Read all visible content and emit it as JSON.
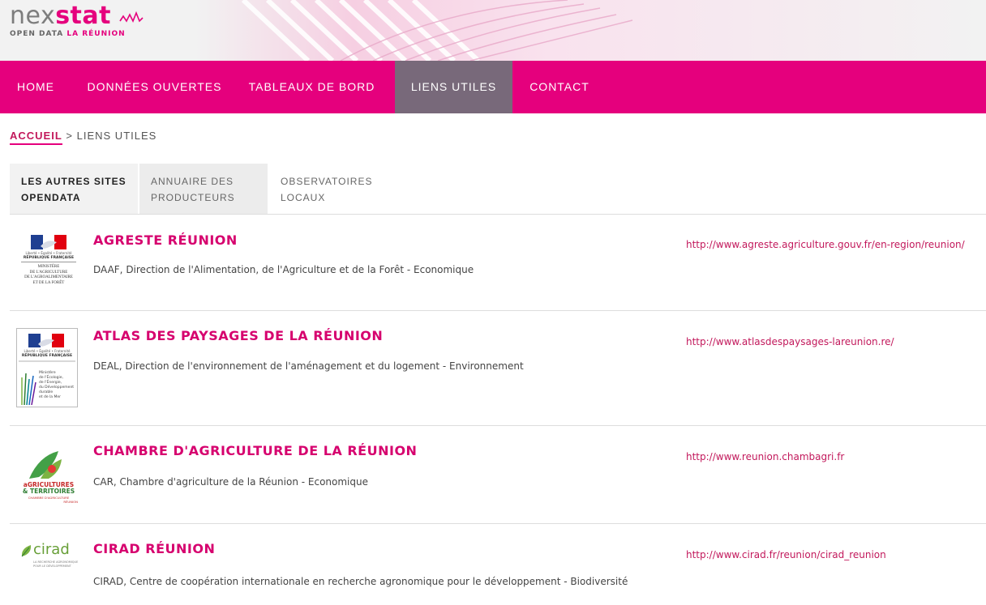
{
  "header": {
    "logo_text_1": "nex",
    "logo_text_2": "stat",
    "logo_sub_1": "OPEN DATA",
    "logo_sub_2": "LA RÉUNION"
  },
  "nav": {
    "items": [
      {
        "label": "HOME"
      },
      {
        "label": "DONNÉES OUVERTES"
      },
      {
        "label": "TABLEAUX DE BORD"
      },
      {
        "label": "LIENS UTILES"
      },
      {
        "label": "CONTACT"
      }
    ],
    "active_index": 3
  },
  "breadcrumb": {
    "home": "ACCUEIL",
    "separator": ">",
    "current": "LIENS UTILES"
  },
  "tabs": [
    {
      "line1": "LES AUTRES SITES",
      "line2": "OPENDATA"
    },
    {
      "line1": "ANNUAIRE DES",
      "line2": "PRODUCTEURS"
    },
    {
      "line1": "OBSERVATOIRES",
      "line2": "LOCAUX"
    }
  ],
  "items": [
    {
      "title": "AGRESTE RÉUNION",
      "description": "DAAF, Direction de l'Alimentation, de l'Agriculture et de la Forêt - Economique",
      "url": "http://www.agreste.agriculture.gouv.fr/en-region/reunion/",
      "logo": {
        "motto": "Liberté • Égalité • Fraternité",
        "republic": "RÉPUBLIQUE FRANÇAISE",
        "ministry_lines": [
          "MINISTÈRE",
          "DE L'AGRICULTURE",
          "DE L'AGROALIMENTAIRE",
          "ET DE LA FORÊT"
        ]
      }
    },
    {
      "title": "ATLAS DES PAYSAGES DE LA RÉUNION",
      "description": "DEAL, Direction de l'environnement de l'aménagement et du logement - Environnement",
      "url": "http://www.atlasdespaysages-lareunion.re/",
      "logo": {
        "motto": "Liberté • Égalité • Fraternité",
        "republic": "RÉPUBLIQUE FRANÇAISE",
        "ministry_lines": [
          "Ministère",
          "de l'Écologie,",
          "de l'Énergie,",
          "du Développement",
          "durable",
          "et de la Mer"
        ]
      }
    },
    {
      "title": "CHAMBRE D'AGRICULTURE DE LA RÉUNION",
      "description": "CAR, Chambre d'agriculture de la Réunion - Economique",
      "url": "http://www.reunion.chambagri.fr",
      "logo": {
        "line1": "aGRICULTURES",
        "line2": "& TERRITOIRES",
        "line3": "CHAMBRE D'AGRICULTURE",
        "line4": "RÉUNION"
      }
    },
    {
      "title": "CIRAD RÉUNION",
      "description": "CIRAD, Centre de coopération internationale en recherche agronomique pour le développement - Biodiversité",
      "url": "http://www.cirad.fr/reunion/cirad_reunion",
      "logo": {
        "name": "cirad",
        "tagline_1": "LA RECHERCHE AGRONOMIQUE",
        "tagline_2": "POUR LE DÉVELOPPEMENT"
      }
    }
  ],
  "colors": {
    "brand": "#e5007d",
    "nav_active": "#78697a",
    "title": "#d6006e"
  }
}
